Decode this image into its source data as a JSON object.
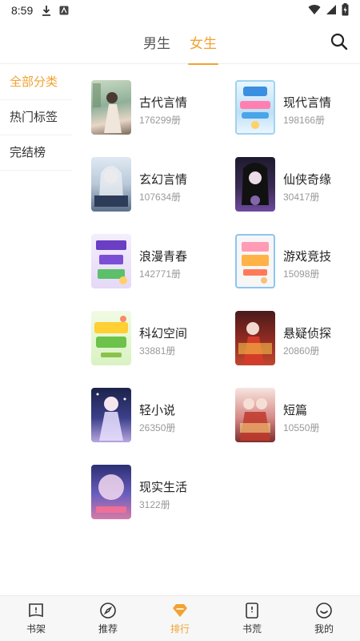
{
  "status": {
    "time": "8:59"
  },
  "header": {
    "tabs": [
      {
        "label": "男生"
      },
      {
        "label": "女生"
      }
    ]
  },
  "sidebar": {
    "items": [
      {
        "label": "全部分类"
      },
      {
        "label": "热门标签"
      },
      {
        "label": "完结榜"
      }
    ]
  },
  "categories": [
    {
      "name": "古代言情",
      "count": "176299册"
    },
    {
      "name": "现代言情",
      "count": "198166册"
    },
    {
      "name": "玄幻言情",
      "count": "107634册"
    },
    {
      "name": "仙侠奇缘",
      "count": "30417册"
    },
    {
      "name": "浪漫青春",
      "count": "142771册"
    },
    {
      "name": "游戏竞技",
      "count": "15098册"
    },
    {
      "name": "科幻空间",
      "count": "33881册"
    },
    {
      "name": "悬疑侦探",
      "count": "20860册"
    },
    {
      "name": "轻小说",
      "count": "26350册"
    },
    {
      "name": "短篇",
      "count": "10550册"
    },
    {
      "name": "现实生活",
      "count": "3122册"
    }
  ],
  "bottom_nav": [
    {
      "label": "书架",
      "icon": "bookshelf-icon"
    },
    {
      "label": "推荐",
      "icon": "compass-icon"
    },
    {
      "label": "排行",
      "icon": "diamond-icon"
    },
    {
      "label": "书荒",
      "icon": "book-icon"
    },
    {
      "label": "我的",
      "icon": "smile-icon"
    }
  ],
  "colors": {
    "accent": "#f0a332"
  }
}
